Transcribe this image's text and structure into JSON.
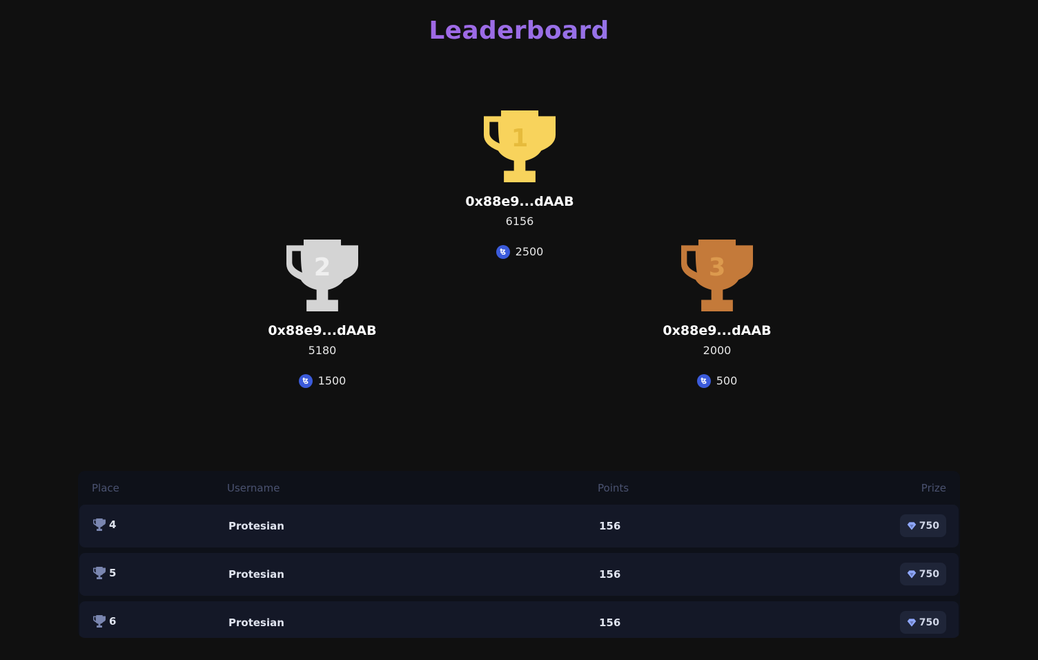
{
  "page": {
    "title": "Leaderboard"
  },
  "podium": {
    "first": {
      "place": "1",
      "name": "0x88e9...dAAB",
      "points": "6156",
      "prize": "2500",
      "color": "#f8d35c"
    },
    "second": {
      "place": "2",
      "name": "0x88e9...dAAB",
      "points": "5180",
      "prize": "1500",
      "color": "#d4d4d4"
    },
    "third": {
      "place": "3",
      "name": "0x88e9...dAAB",
      "points": "2000",
      "prize": "500",
      "color": "#c47a3a"
    }
  },
  "coin_icon": "ctez-coin-icon",
  "table": {
    "headers": {
      "place": "Place",
      "username": "Username",
      "points": "Points",
      "prize": "Prize"
    },
    "rows": [
      {
        "place": "4",
        "username": "Protesian",
        "points": "156",
        "prize": "750"
      },
      {
        "place": "5",
        "username": "Protesian",
        "points": "156",
        "prize": "750"
      },
      {
        "place": "6",
        "username": "Protesian",
        "points": "156",
        "prize": "750"
      }
    ]
  },
  "colors": {
    "background": "#101010",
    "title_gradient_start": "#b453e0",
    "title_gradient_end": "#7d8ff0",
    "coin": "#3b5bdb",
    "row_background": "#141827"
  }
}
